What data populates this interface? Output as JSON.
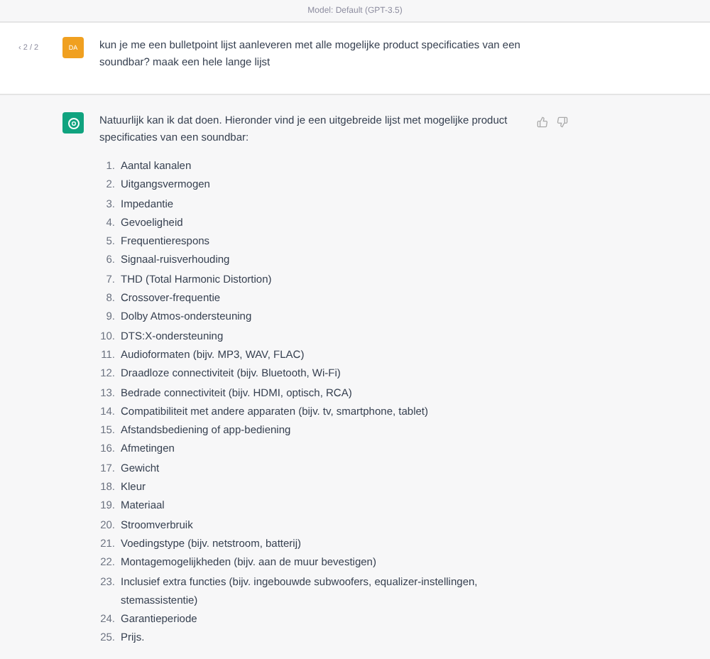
{
  "header": {
    "model_label": "Model: Default (GPT-3.5)"
  },
  "user_message": {
    "pager": "‹ 2 / 2",
    "avatar": "DA",
    "text": "kun je me een bulletpoint lijst aanleveren met alle mogelijke product specificaties van een soundbar? maak een hele lange lijst"
  },
  "assistant_message": {
    "intro": "Natuurlijk kan ik dat doen. Hieronder vind je een uitgebreide lijst met mogelijke product specificaties van een soundbar:",
    "items": [
      {
        "number": "1.",
        "text": "Aantal kanalen"
      },
      {
        "number": "2.",
        "text": "Uitgangsvermogen"
      },
      {
        "number": "3.",
        "text": "Impedantie"
      },
      {
        "number": "4.",
        "text": "Gevoeligheid"
      },
      {
        "number": "5.",
        "text": "Frequentierespons"
      },
      {
        "number": "6.",
        "text": "Signaal-ruisverhouding"
      },
      {
        "number": "7.",
        "text": "THD (Total Harmonic Distortion)"
      },
      {
        "number": "8.",
        "text": "Crossover-frequentie"
      },
      {
        "number": "9.",
        "text": "Dolby Atmos-ondersteuning"
      },
      {
        "number": "10.",
        "text": "DTS:X-ondersteuning"
      },
      {
        "number": "11.",
        "text": "Audioformaten (bijv. MP3, WAV, FLAC)"
      },
      {
        "number": "12.",
        "text": "Draadloze connectiviteit (bijv. Bluetooth, Wi-Fi)"
      },
      {
        "number": "13.",
        "text": "Bedrade connectiviteit (bijv. HDMI, optisch, RCA)"
      },
      {
        "number": "14.",
        "text": "Compatibiliteit met andere apparaten (bijv. tv, smartphone, tablet)"
      },
      {
        "number": "15.",
        "text": "Afstandsbediening of app-bediening"
      },
      {
        "number": "16.",
        "text": "Afmetingen"
      },
      {
        "number": "17.",
        "text": "Gewicht"
      },
      {
        "number": "18.",
        "text": "Kleur"
      },
      {
        "number": "19.",
        "text": "Materiaal"
      },
      {
        "number": "20.",
        "text": "Stroomverbruik"
      },
      {
        "number": "21.",
        "text": "Voedingstype (bijv. netstroom, batterij)"
      },
      {
        "number": "22.",
        "text": "Montagemogelijkheden (bijv. aan de muur bevestigen)"
      },
      {
        "number": "23.",
        "text": "Inclusief extra functies (bijv. ingebouwde subwoofers, equalizer-instellingen, stemassistentie)"
      },
      {
        "number": "24.",
        "text": "Garantieperiode"
      },
      {
        "number": "25.",
        "text": "Prijs."
      }
    ]
  }
}
